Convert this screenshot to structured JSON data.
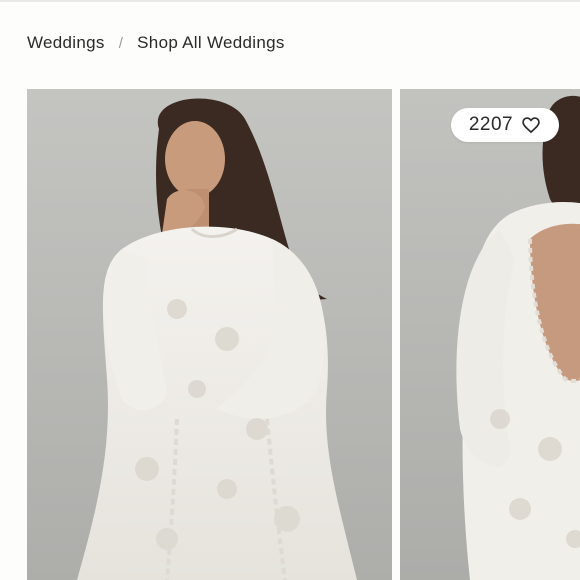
{
  "breadcrumb": {
    "items": [
      {
        "label": "Weddings"
      },
      {
        "label": "Shop All Weddings"
      }
    ],
    "separator": "/"
  },
  "product_gallery": {
    "images": [
      {
        "alt": "model in white lace long-sleeve mini dress, front view"
      },
      {
        "alt": "model in white lace mini dress, back view with open back"
      }
    ],
    "like_button": {
      "count": "2207",
      "icon": "heart-outline-icon"
    }
  },
  "colors": {
    "background": "#fdfdfb",
    "photo_backdrop": "#b9b9b6",
    "text": "#2b2b2b"
  }
}
